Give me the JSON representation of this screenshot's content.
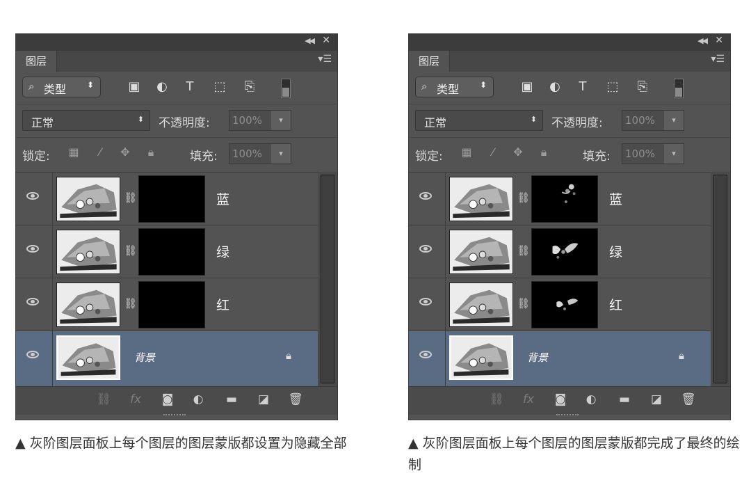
{
  "panels": [
    {
      "tab": "图层",
      "filter": {
        "label": "类型"
      },
      "blend_mode": "正常",
      "opacity_label": "不透明度:",
      "opacity_value": "100%",
      "lock_label": "锁定:",
      "fill_label": "填充:",
      "fill_value": "100%",
      "layers": [
        {
          "name": "蓝",
          "mask": "black"
        },
        {
          "name": "绿",
          "mask": "black"
        },
        {
          "name": "红",
          "mask": "black"
        },
        {
          "name": "背景",
          "selected": true
        }
      ]
    },
    {
      "tab": "图层",
      "filter": {
        "label": "类型"
      },
      "blend_mode": "正常",
      "opacity_label": "不透明度:",
      "opacity_value": "100%",
      "lock_label": "锁定:",
      "fill_label": "填充:",
      "fill_value": "100%",
      "layers": [
        {
          "name": "蓝",
          "mask": "painted"
        },
        {
          "name": "绿",
          "mask": "painted"
        },
        {
          "name": "红",
          "mask": "painted"
        },
        {
          "name": "背景",
          "selected": true
        }
      ]
    }
  ],
  "captions": [
    "▲ 灰阶图层面板上每个图层的图层蒙版都设置为隐藏全部",
    "▲ 灰阶图层面板上每个图层的图层蒙版都完成了最终的绘制"
  ],
  "colors": {
    "panel_bg": "#535353",
    "selected_layer": "#5a6b84",
    "titlebar": "#3c3c3c"
  },
  "icons": [
    "search-icon",
    "image-filter-icon",
    "adjustment-filter-icon",
    "type-filter-icon",
    "shape-filter-icon",
    "smart-object-filter-icon",
    "eye-icon",
    "chain-link-icon",
    "lock-icon",
    "fx-icon",
    "mask-icon",
    "folder-icon",
    "new-layer-icon",
    "trash-icon"
  ]
}
